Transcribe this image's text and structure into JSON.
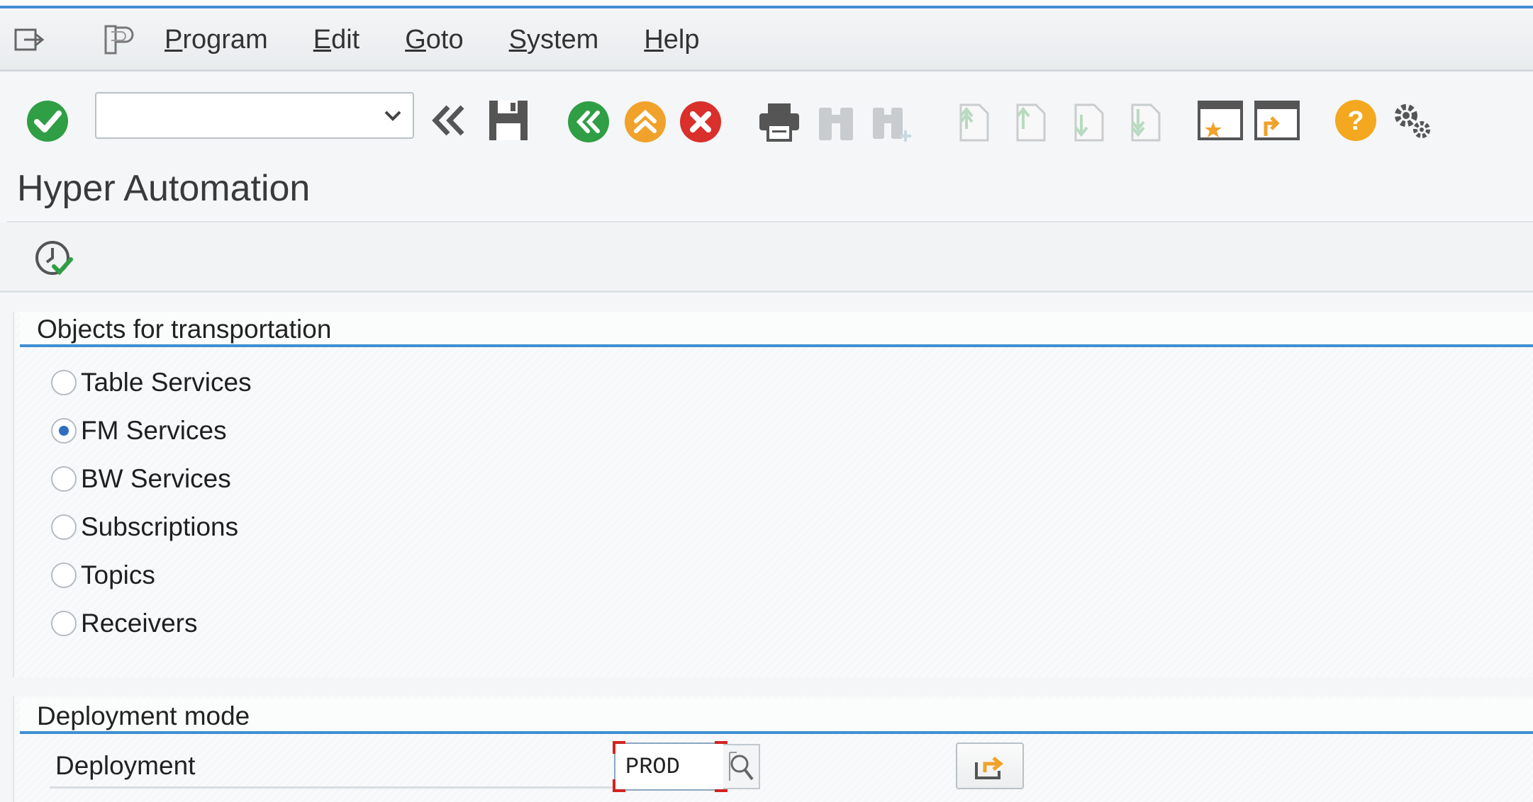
{
  "menu": {
    "items": [
      {
        "pre": "",
        "u": "P",
        "post": "rogram"
      },
      {
        "pre": "",
        "u": "E",
        "post": "dit"
      },
      {
        "pre": "",
        "u": "G",
        "post": "oto"
      },
      {
        "pre": "",
        "u": "S",
        "post": "ystem"
      },
      {
        "pre": "",
        "u": "H",
        "post": "elp"
      }
    ]
  },
  "toolbar": {
    "command_value": "",
    "icons": [
      "enter-icon",
      "command-dropdown-icon",
      "collapse-icon",
      "save-icon",
      "back-icon",
      "exit-icon",
      "cancel-icon",
      "print-icon",
      "find-icon",
      "find-next-icon",
      "first-page-icon",
      "previous-page-icon",
      "next-page-icon",
      "last-page-icon",
      "new-session-icon",
      "create-shortcut-icon",
      "help-icon",
      "settings-icon"
    ],
    "colors": {
      "green": "#2f9e44",
      "orange": "#f0a22a",
      "red": "#d9302c",
      "help": "#f3a81f"
    }
  },
  "title": "Hyper Automation",
  "app_toolbar": {
    "icons": [
      "execute-clock-icon"
    ]
  },
  "objects_panel": {
    "heading": "Objects for transportation",
    "options": [
      {
        "label": "Table Services",
        "selected": false
      },
      {
        "label": "FM Services",
        "selected": true
      },
      {
        "label": "BW Services",
        "selected": false
      },
      {
        "label": "Subscriptions",
        "selected": false
      },
      {
        "label": "Topics",
        "selected": false
      },
      {
        "label": "Receivers",
        "selected": false
      }
    ]
  },
  "deployment_panel": {
    "heading": "Deployment mode",
    "field_label": "Deployment",
    "field_value": "PROD",
    "icons": [
      "value-help-icon",
      "export-icon"
    ]
  }
}
